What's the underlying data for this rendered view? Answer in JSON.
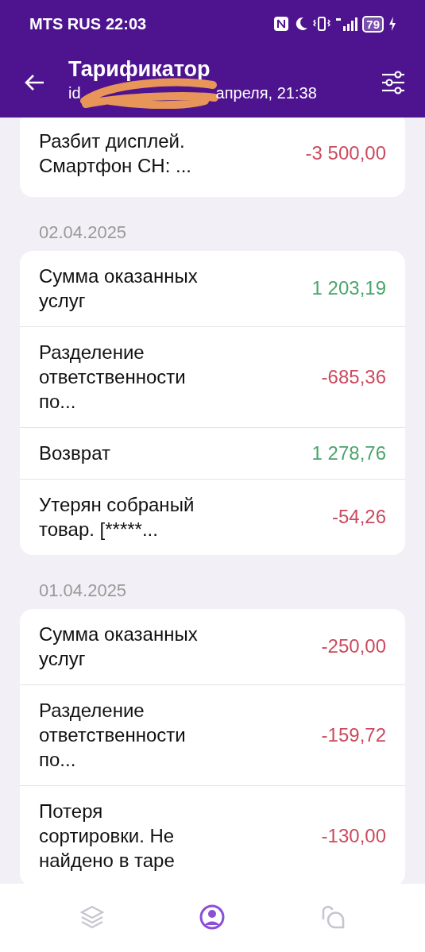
{
  "status_bar": {
    "carrier": "MTS RUS",
    "time": "22:03",
    "battery": "79"
  },
  "header": {
    "title": "Тарификатор",
    "subtitle_start": "id",
    "subtitle_end": "апреля, 21:38"
  },
  "groups": [
    {
      "rows": [
        {
          "label": "Разбит дисплей. Смартфон CH: ...",
          "amount": "-3 500,00",
          "kind": "charge"
        }
      ]
    },
    {
      "date": "02.04.2025",
      "rows": [
        {
          "label": "Сумма оказанных услуг",
          "amount": "1 203,19",
          "kind": "income"
        },
        {
          "label": "Разделение ответственности по...",
          "amount": "-685,36",
          "kind": "charge"
        },
        {
          "label": "Возврат",
          "amount": "1 278,76",
          "kind": "income"
        },
        {
          "label": "Утерян собраный товар. [*****...",
          "amount": "-54,26",
          "kind": "charge"
        }
      ]
    },
    {
      "date": "01.04.2025",
      "rows": [
        {
          "label": "Сумма оказанных услуг",
          "amount": "-250,00",
          "kind": "charge"
        },
        {
          "label": "Разделение ответственности по...",
          "amount": "-159,72",
          "kind": "charge"
        },
        {
          "label": "Потеря сортировки. Не найдено в таре",
          "amount": "-130,00",
          "kind": "charge"
        }
      ]
    }
  ],
  "nav": [
    {
      "selected": false
    },
    {
      "selected": true
    },
    {
      "selected": false
    }
  ]
}
